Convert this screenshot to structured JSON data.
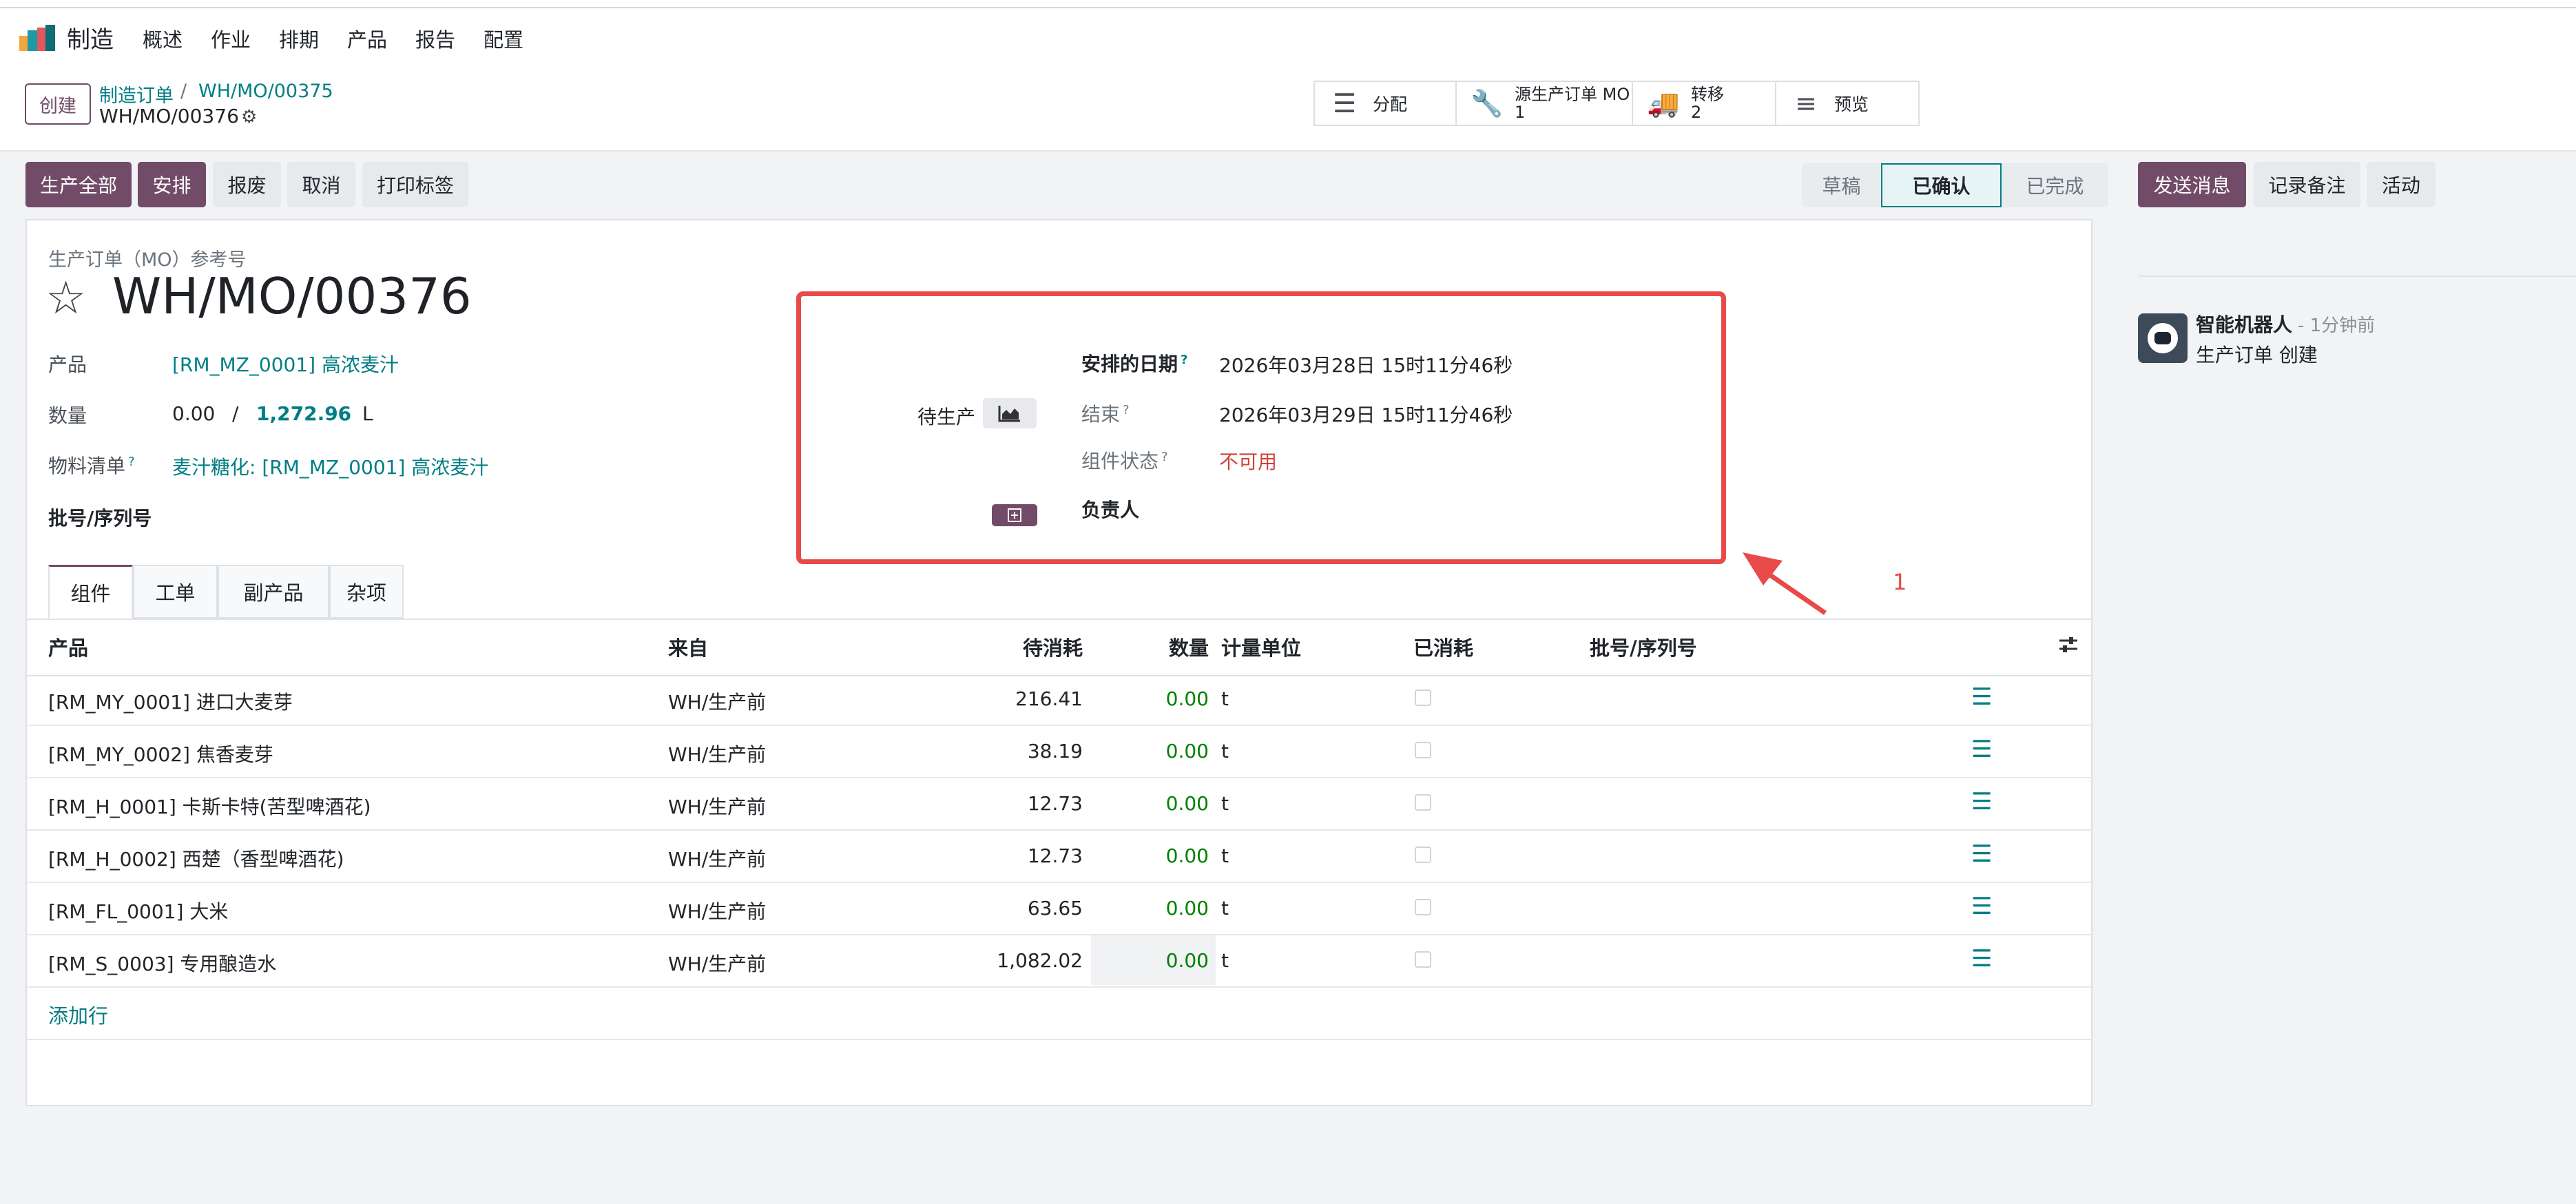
{
  "nav": {
    "app_name": "制造",
    "items": [
      "概述",
      "作业",
      "排期",
      "产品",
      "报告",
      "配置"
    ]
  },
  "control": {
    "create_label": "创建",
    "breadcrumb": [
      "制造订单",
      "WH/MO/00375"
    ],
    "breadcrumb_sep": "/",
    "current": "WH/MO/00376",
    "smart_buttons": [
      {
        "icon": "list-icon",
        "label": "分配"
      },
      {
        "icon": "wrench-icon",
        "label": "源生产订单 MO",
        "count": "1"
      },
      {
        "icon": "truck-icon",
        "label": "转移",
        "count": "2"
      },
      {
        "icon": "menu-icon",
        "label": "预览"
      }
    ]
  },
  "actions": {
    "produce_all": "生产全部",
    "plan": "安排",
    "scrap": "报废",
    "cancel": "取消",
    "print_labels": "打印标签"
  },
  "statusbar": [
    "草稿",
    "已确认",
    "已完成"
  ],
  "status_current": "已确认",
  "chatter": {
    "send_message": "发送消息",
    "log_note": "记录备注",
    "activity": "活动",
    "author": "智能机器人",
    "time": "- 1分钟前",
    "body": "生产订单 创建"
  },
  "form": {
    "ref_label": "生产订单（MO）参考号",
    "name": "WH/MO/00376",
    "product_label": "产品",
    "product_value": "[RM_MZ_0001] 高浓麦汁",
    "qty_label": "数量",
    "qty_done": "0.00",
    "qty_sep": "/",
    "qty_total": "1,272.96",
    "qty_uom": "L",
    "bom_label": "物料清单",
    "bom_help": "?",
    "bom_value": "麦汁糖化: [RM_MZ_0001] 高浓麦汁",
    "lot_label": "批号/序列号",
    "pending_label": "待生产",
    "scheduled_label": "安排的日期",
    "scheduled_help": "?",
    "scheduled_value": "2026年03月28日 15时11分46秒",
    "end_label": "结束",
    "end_help": "?",
    "end_value": "2026年03月29日 15时11分46秒",
    "component_status_label": "组件状态",
    "component_status_help": "?",
    "component_status_value": "不可用",
    "responsible_label": "负责人",
    "annotation_number": "1"
  },
  "tabs": [
    "组件",
    "工单",
    "副产品",
    "杂项"
  ],
  "table": {
    "headers": [
      "产品",
      "来自",
      "待消耗",
      "数量",
      "计量单位",
      "已消耗",
      "批号/序列号"
    ],
    "rows": [
      {
        "product": "[RM_MY_0001] 进口大麦芽",
        "from": "WH/生产前",
        "to_consume": "216.41",
        "qty": "0.00",
        "uom": "t"
      },
      {
        "product": "[RM_MY_0002] 焦香麦芽",
        "from": "WH/生产前",
        "to_consume": "38.19",
        "qty": "0.00",
        "uom": "t"
      },
      {
        "product": "[RM_H_0001] 卡斯卡特(苦型啤酒花)",
        "from": "WH/生产前",
        "to_consume": "12.73",
        "qty": "0.00",
        "uom": "t"
      },
      {
        "product": "[RM_H_0002] 西楚（香型啤酒花)",
        "from": "WH/生产前",
        "to_consume": "12.73",
        "qty": "0.00",
        "uom": "t"
      },
      {
        "product": "[RM_FL_0001] 大米",
        "from": "WH/生产前",
        "to_consume": "63.65",
        "qty": "0.00",
        "uom": "t"
      },
      {
        "product": "[RM_S_0003] 专用酿造水",
        "from": "WH/生产前",
        "to_consume": "1,082.02",
        "qty": "0.00",
        "uom": "t"
      }
    ],
    "add_line": "添加行"
  },
  "colors": {
    "brand": "#714b67",
    "link": "#017e84",
    "annotation": "#e84a4a",
    "danger": "#d23f3a"
  }
}
